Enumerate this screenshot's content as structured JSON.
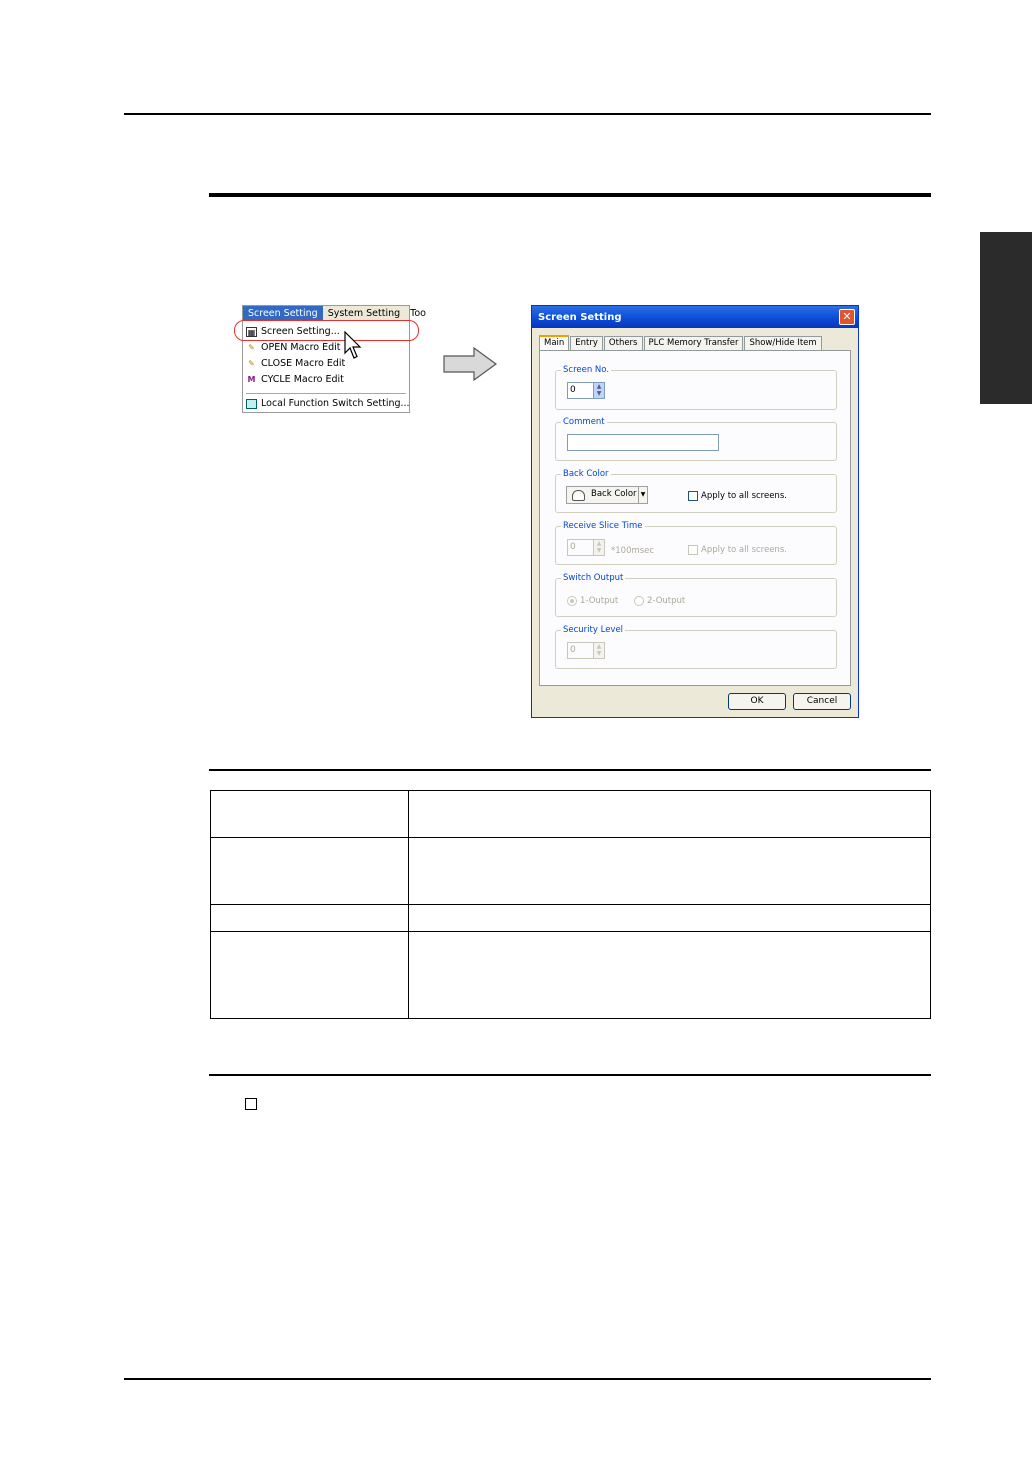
{
  "menu": {
    "bar": [
      "Screen Setting",
      "System Setting",
      "Too"
    ],
    "items": [
      {
        "label": "Screen Setting...",
        "icon": "screen-setting-icon"
      },
      {
        "label": "OPEN Macro Edit",
        "icon": "open-macro-icon"
      },
      {
        "label": "CLOSE Macro Edit",
        "icon": "close-macro-icon"
      },
      {
        "label": "CYCLE Macro Edit",
        "icon": "cycle-macro-icon"
      },
      {
        "label": "Local Function Switch Setting...",
        "icon": "local-function-icon"
      }
    ]
  },
  "dialog": {
    "title": "Screen Setting",
    "tabs": [
      "Main",
      "Entry",
      "Others",
      "PLC Memory Transfer",
      "Show/Hide Item"
    ],
    "screen_no": {
      "label": "Screen No.",
      "value": "0"
    },
    "comment": {
      "label": "Comment",
      "value": ""
    },
    "back_color": {
      "label": "Back Color",
      "button": "Back Color",
      "apply_all": "Apply to all screens."
    },
    "receive_slice": {
      "label": "Receive Slice Time",
      "value": "0",
      "unit": "*100msec",
      "apply_all": "Apply to all screens."
    },
    "switch_output": {
      "label": "Switch Output",
      "option1": "1-Output",
      "option2": "2-Output",
      "selected": "1-Output"
    },
    "security": {
      "label": "Security Level",
      "value": "0"
    },
    "ok": "OK",
    "cancel": "Cancel"
  },
  "colors": {
    "title_bar": "#0a4ad6",
    "highlight": "#e53030",
    "side_tab": "#2b2b2b"
  }
}
